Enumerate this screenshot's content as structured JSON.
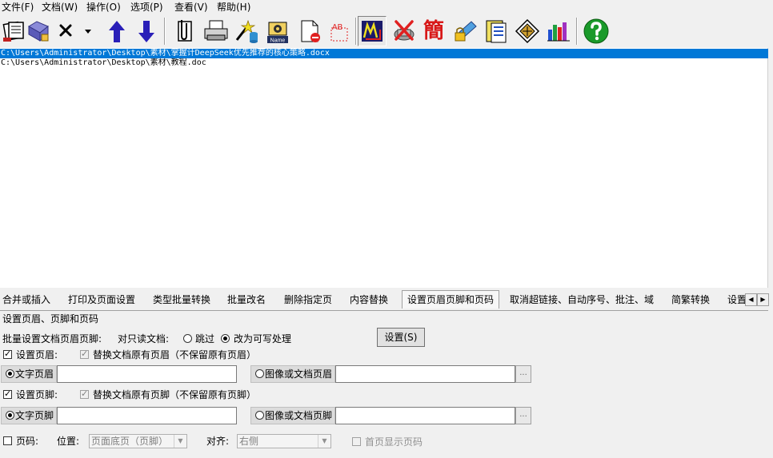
{
  "menu": [
    {
      "label": "文件(F)"
    },
    {
      "label": "文档(W)"
    },
    {
      "label": "操作(O)"
    },
    {
      "label": "选项(P)"
    },
    {
      "label": "查看(V)"
    },
    {
      "label": "帮助(H)"
    }
  ],
  "toolbar": {
    "jian_glyph": "簡",
    "name_tag": "Name",
    "ab_text": "AB"
  },
  "files": [
    {
      "path": "C:\\Users\\Administrator\\Desktop\\素材\\掌握计DeepSeek优先推荐的核心策略.docx"
    },
    {
      "path": "C:\\Users\\Administrator\\Desktop\\素材\\教程.doc"
    }
  ],
  "tabs": [
    {
      "label": "合并或插入"
    },
    {
      "label": "打印及页面设置"
    },
    {
      "label": "类型批量转换"
    },
    {
      "label": "批量改名"
    },
    {
      "label": "删除指定页"
    },
    {
      "label": "内容替换"
    },
    {
      "label": "设置页眉页脚和页码"
    },
    {
      "label": "取消超链接、自动序号、批注、域"
    },
    {
      "label": "简繁转换"
    },
    {
      "label": "设置"
    }
  ],
  "tab_arrows": {
    "left": "◀",
    "right": "▶"
  },
  "panel": {
    "group_title": "设置页眉、页脚和页码",
    "batch_label": "批量设置文档页眉页脚:",
    "readonly_label": "对只读文档:",
    "skip_label": "跳过",
    "writable_label": "改为可写处理",
    "setup_button": "设置(S)",
    "header": {
      "set_label": "设置页眉:",
      "replace_label": "替换文档原有页眉（不保留原有页眉）",
      "text_label": "文字页眉",
      "text_value": "",
      "image_label": "图像或文档页眉",
      "image_value": "",
      "browse": "..."
    },
    "footer": {
      "set_label": "设置页脚:",
      "replace_label": "替换文档原有页脚（不保留原有页脚）",
      "text_label": "文字页脚",
      "text_value": "",
      "image_label": "图像或文档页脚",
      "image_value": "",
      "browse": "..."
    },
    "page_number": {
      "label": "页码:",
      "position_label": "位置:",
      "position_value": "页面底页（页脚）",
      "align_label": "对齐:",
      "align_value": "右侧",
      "first_page_label": "首页显示页码"
    }
  },
  "colors": {
    "selection": "#0078d7",
    "arrow_blue": "#2a1fb8",
    "help_green": "#1a9a2a",
    "jian_red": "#d81818"
  }
}
